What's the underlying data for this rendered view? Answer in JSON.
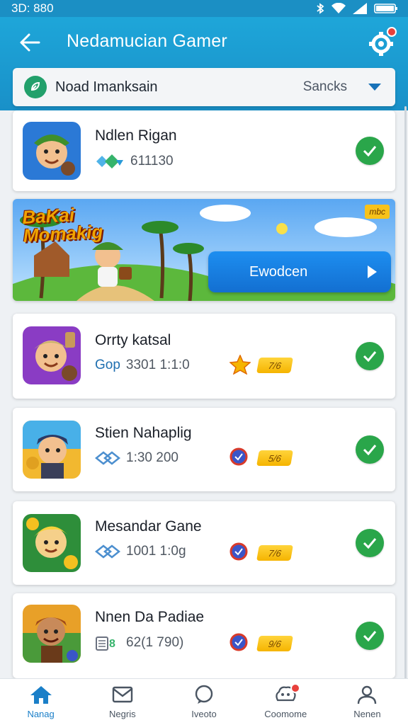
{
  "status_bar": {
    "time": "3D: 880"
  },
  "header": {
    "title": "Nedamucian Gamer"
  },
  "filter": {
    "label": "Noad Imanksain",
    "sort": "Sancks"
  },
  "banner": {
    "title_line1": "BaKai",
    "title_line2": "Momakig",
    "badge": "mbc",
    "button_label": "Ewodcen"
  },
  "games": [
    {
      "name": "Ndlen Rigan",
      "meta_prefix": "",
      "meta_value": "611130",
      "pill": "",
      "has_medal": false
    },
    {
      "name": "Orrty katsal",
      "meta_prefix": "Gop",
      "meta_value": "3301 1:1:0",
      "pill": "7/6",
      "has_medal": true
    },
    {
      "name": "Stien Nahaplig",
      "meta_prefix": "",
      "meta_value": "1:30 200",
      "pill": "5/6",
      "has_medal": true
    },
    {
      "name": "Mesandar Gane",
      "meta_prefix": "",
      "meta_value": "1001 1:0g",
      "pill": "7/6",
      "has_medal": true
    },
    {
      "name": "Nnen Da Padiae",
      "meta_prefix": "",
      "meta_value": "62(1 790)",
      "pill": "9/6",
      "has_medal": true
    }
  ],
  "nav": {
    "items": [
      {
        "label": "Nanag",
        "icon": "home-icon"
      },
      {
        "label": "Negris",
        "icon": "mail-icon"
      },
      {
        "label": "Iveoto",
        "icon": "chat-icon"
      },
      {
        "label": "Coomome",
        "icon": "community-icon"
      },
      {
        "label": "Nenen",
        "icon": "profile-icon"
      }
    ]
  },
  "colors": {
    "primary": "#1ea6d9",
    "success": "#2aa64a",
    "accent": "#f5b400"
  }
}
